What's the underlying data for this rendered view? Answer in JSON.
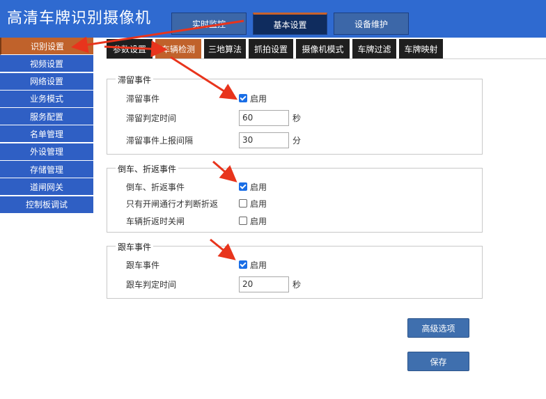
{
  "header": {
    "title": "高清车牌识别摄像机",
    "tabs": [
      {
        "label": "实时监控"
      },
      {
        "label": "基本设置"
      },
      {
        "label": "设备维护"
      }
    ]
  },
  "sidebar": {
    "items": [
      {
        "label": "识别设置"
      },
      {
        "label": "视频设置"
      },
      {
        "label": "网络设置"
      },
      {
        "label": "业务模式"
      },
      {
        "label": "服务配置"
      },
      {
        "label": "名单管理"
      },
      {
        "label": "外设管理"
      },
      {
        "label": "存储管理"
      },
      {
        "label": "道闸网关"
      },
      {
        "label": "控制板调试"
      }
    ]
  },
  "subtabs": [
    {
      "label": "参数设置"
    },
    {
      "label": "车辆检测"
    },
    {
      "label": "三地算法"
    },
    {
      "label": "抓拍设置"
    },
    {
      "label": "摄像机模式"
    },
    {
      "label": "车牌过滤"
    },
    {
      "label": "车牌映射"
    }
  ],
  "groups": {
    "stay": {
      "title": "滞留事件",
      "event_label": "滞留事件",
      "enable_text": "启用",
      "time_label": "滞留判定时间",
      "time_value": "60",
      "time_unit": "秒",
      "interval_label": "滞留事件上报间隔",
      "interval_value": "30",
      "interval_unit": "分"
    },
    "reverse": {
      "title": "倒车、折返事件",
      "event_label": "倒车、折返事件",
      "enable_text": "启用",
      "only_open_label": "只有开闸通行才判断折返",
      "only_open_text": "启用",
      "close_label": "车辆折返时关闸",
      "close_text": "启用"
    },
    "follow": {
      "title": "跟车事件",
      "event_label": "跟车事件",
      "enable_text": "启用",
      "time_label": "跟车判定时间",
      "time_value": "20",
      "time_unit": "秒"
    }
  },
  "buttons": {
    "advanced": "高级选项",
    "save": "保存"
  },
  "colors": {
    "header": "#2f6ad0",
    "sidebar": "#2f5fc4",
    "active": "#c0622b",
    "arrow": "#e8341c"
  }
}
